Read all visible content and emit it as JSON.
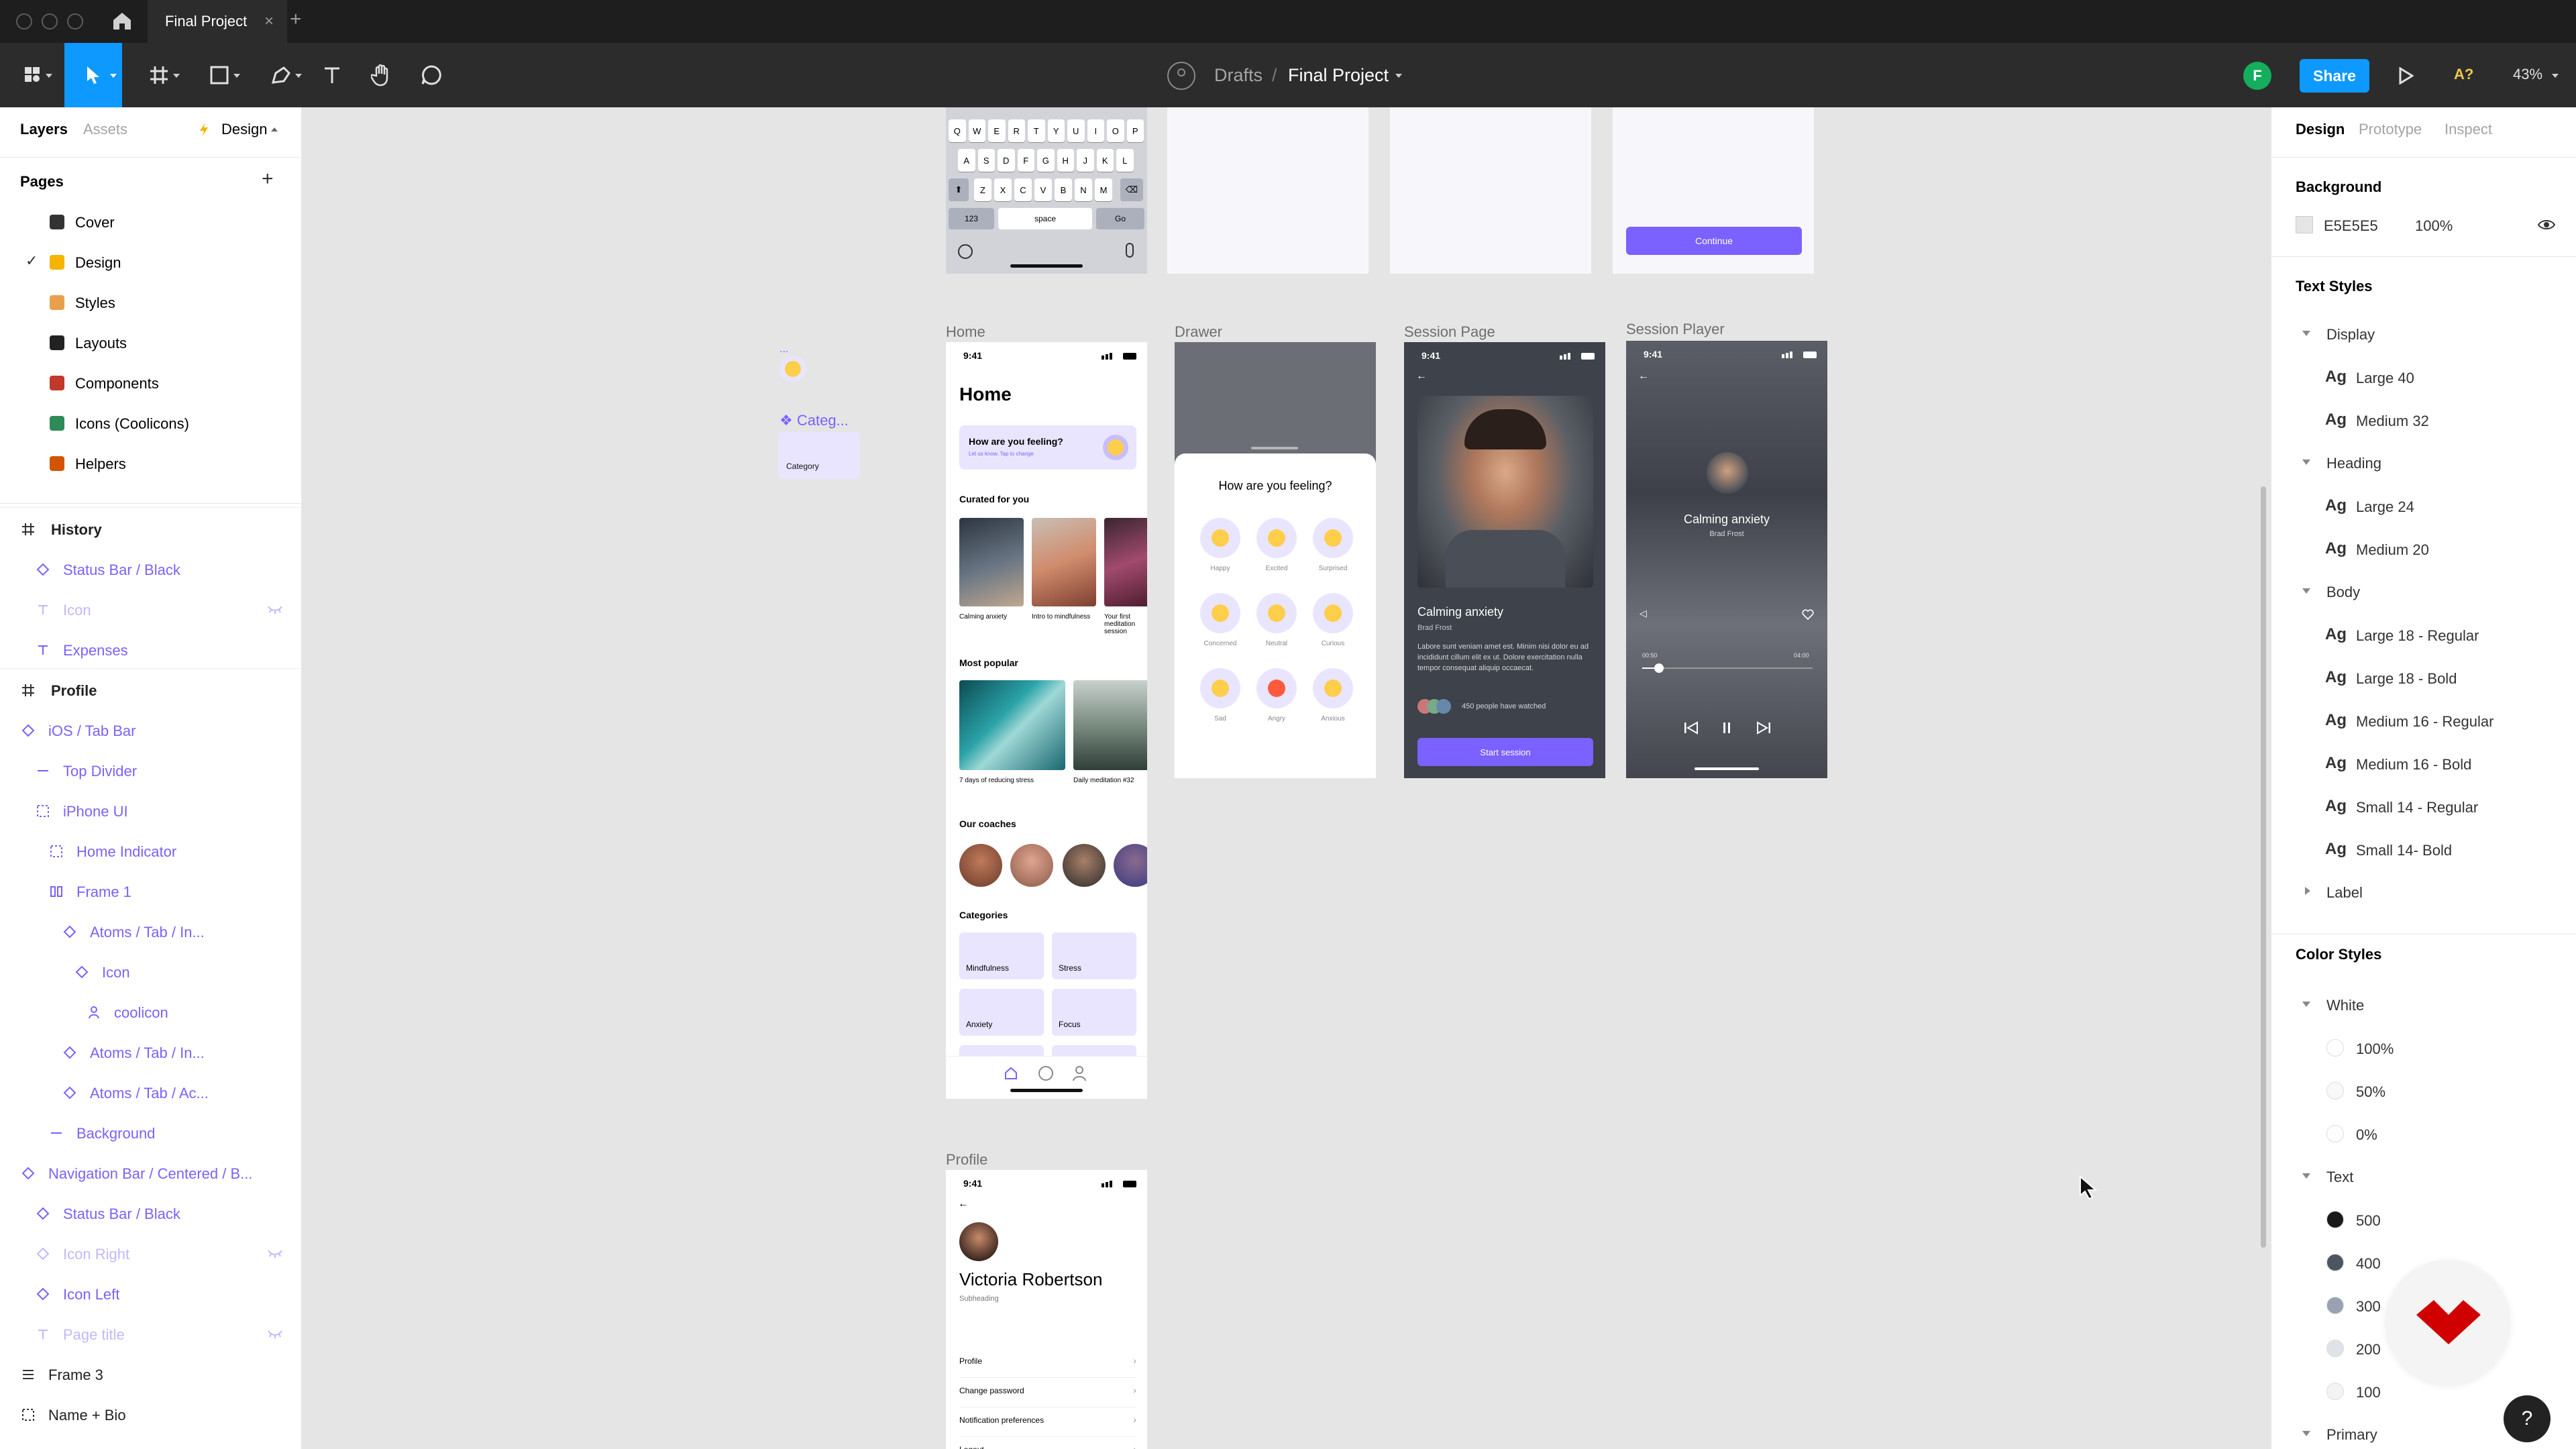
{
  "titlebar": {
    "tab_title": "Final Project",
    "tab_close": "×",
    "new_tab": "+"
  },
  "toolbar": {
    "breadcrumb_drafts": "Drafts",
    "breadcrumb_sep": "/",
    "breadcrumb_project": "Final Project",
    "avatar_initial": "F",
    "share_label": "Share",
    "font_badge": "A?",
    "zoom": "43%"
  },
  "left_panel": {
    "tabs": {
      "layers": "Layers",
      "assets": "Assets",
      "page": "Design"
    },
    "pages_title": "Pages",
    "pages_add": "+",
    "pages": [
      {
        "label": "Cover",
        "emoji_color": "#333333"
      },
      {
        "label": "Design",
        "emoji_color": "#f5b400",
        "current": true
      },
      {
        "label": "Styles",
        "emoji_color": "#e8a04c"
      },
      {
        "label": "Layouts",
        "emoji_color": "#222222"
      },
      {
        "label": "Components",
        "emoji_color": "#c0392b"
      },
      {
        "label": "Icons (Coolicons)",
        "emoji_color": "#2e8b57"
      },
      {
        "label": "Helpers",
        "emoji_color": "#d35400"
      }
    ],
    "layers": [
      {
        "label": "History",
        "type": "frame",
        "indent": 0
      },
      {
        "label": "Status Bar / Black",
        "type": "instance",
        "indent": 1
      },
      {
        "label": "Icon",
        "type": "text",
        "indent": 1,
        "hidden": true
      },
      {
        "label": "Expenses",
        "type": "text",
        "indent": 1
      },
      {
        "label": "Profile",
        "type": "frame",
        "indent": 0
      },
      {
        "label": "iOS / Tab Bar",
        "type": "instance",
        "indent": 0
      },
      {
        "label": "Top Divider",
        "type": "line",
        "indent": 1
      },
      {
        "label": "iPhone UI",
        "type": "group",
        "indent": 1
      },
      {
        "label": "Home Indicator",
        "type": "group",
        "indent": 2
      },
      {
        "label": "Frame 1",
        "type": "autolayout",
        "indent": 2
      },
      {
        "label": "Atoms / Tab / In...",
        "type": "instance",
        "indent": 3
      },
      {
        "label": "Icon",
        "type": "instance",
        "indent": 4
      },
      {
        "label": "coolicon",
        "type": "vector",
        "indent": 5
      },
      {
        "label": "Atoms / Tab / In...",
        "type": "instance",
        "indent": 3
      },
      {
        "label": "Atoms / Tab / Ac...",
        "type": "instance",
        "indent": 3
      },
      {
        "label": "Background",
        "type": "line",
        "indent": 2
      },
      {
        "label": "Navigation Bar / Centered / B...",
        "type": "instance",
        "indent": 0
      },
      {
        "label": "Status Bar / Black",
        "type": "instance",
        "indent": 1
      },
      {
        "label": "Icon Right",
        "type": "instance",
        "indent": 1,
        "hidden": true
      },
      {
        "label": "Icon Left",
        "type": "instance",
        "indent": 1
      },
      {
        "label": "Page title",
        "type": "text",
        "indent": 1,
        "hidden": true
      },
      {
        "label": "Frame 3",
        "type": "autolayout-dark",
        "indent": 0
      },
      {
        "label": "Name + Bio",
        "type": "group-dark",
        "indent": 0
      }
    ]
  },
  "canvas": {
    "keyboard": {
      "row1": [
        "Q",
        "W",
        "E",
        "R",
        "T",
        "Y",
        "U",
        "I",
        "O",
        "P"
      ],
      "row2": [
        "A",
        "S",
        "D",
        "F",
        "G",
        "H",
        "J",
        "K",
        "L"
      ],
      "row3": [
        "Z",
        "X",
        "C",
        "V",
        "B",
        "N",
        "M"
      ],
      "num_key": "123",
      "space_key": "space",
      "go_key": "Go"
    },
    "continue_label": "Continue",
    "component_label": "Categ...",
    "component_dots": "...",
    "component_card_label": "Category",
    "home": {
      "frame_label": "Home",
      "time": "9:41",
      "title": "Home",
      "feeling_q": "How are you feeling?",
      "feeling_sub": "Let us know. Tap to change",
      "curated_title": "Curated for you",
      "curated": [
        "Calming anxiety",
        "Intro to mindfulness",
        "Your first meditation session"
      ],
      "popular_title": "Most popular",
      "popular": [
        "7 days of reducing stress",
        "Daily meditation #32"
      ],
      "coaches_title": "Our coaches",
      "categories_title": "Categories",
      "categories": [
        "Mindfulness",
        "Stress",
        "Anxiety",
        "Focus"
      ]
    },
    "drawer": {
      "frame_label": "Drawer",
      "question": "How are you feeling?",
      "moods": [
        "Happy",
        "Excited",
        "Surprised",
        "Concerned",
        "Neutral",
        "Curious",
        "Sad",
        "Angry",
        "Anxious"
      ]
    },
    "session_page": {
      "frame_label": "Session Page",
      "time": "9:41",
      "title": "Calming anxiety",
      "author": "Brad Frost",
      "body": "Labore sunt veniam amet est. Minim nisi dolor eu ad incididunt cillum elit ex ut. Dolore exercitation nulla tempor consequat aliquip occaecat.",
      "watched": "450 people have watched",
      "cta": "Start session"
    },
    "session_player": {
      "frame_label": "Session Player",
      "time": "9:41",
      "title": "Calming anxiety",
      "author": "Brad Frost",
      "elapsed": "00:50",
      "total": "04:00",
      "progress": 0.1
    },
    "profile": {
      "frame_label": "Profile",
      "time": "9:41",
      "name": "Victoria Robertson",
      "subheading": "Subheading",
      "menu": [
        "Profile",
        "Change password",
        "Notification preferences",
        "Logout"
      ]
    }
  },
  "right_panel": {
    "tabs": {
      "design": "Design",
      "prototype": "Prototype",
      "inspect": "Inspect"
    },
    "background_title": "Background",
    "background_hex": "E5E5E5",
    "background_opacity": "100%",
    "text_styles_title": "Text Styles",
    "text_style_groups": [
      {
        "name": "Display",
        "expanded": true,
        "styles": [
          "Large 40",
          "Medium 32"
        ]
      },
      {
        "name": "Heading",
        "expanded": true,
        "styles": [
          "Large 24",
          "Medium 20"
        ]
      },
      {
        "name": "Body",
        "expanded": true,
        "styles": [
          "Large 18 - Regular",
          "Large 18 - Bold",
          "Medium 16 - Regular",
          "Medium 16 - Bold",
          "Small 14 - Regular",
          "Small 14- Bold"
        ]
      },
      {
        "name": "Label",
        "expanded": false,
        "styles": []
      }
    ],
    "ag": "Ag",
    "color_styles_title": "Color Styles",
    "color_groups": [
      {
        "name": "White",
        "swatches": [
          {
            "label": "100%",
            "color": "#ffffff"
          },
          {
            "label": "50%",
            "color": "#f8f8f8"
          },
          {
            "label": "0%",
            "color": "#fdfdfd"
          }
        ]
      },
      {
        "name": "Text",
        "swatches": [
          {
            "label": "500",
            "color": "#1a1a1a"
          },
          {
            "label": "400",
            "color": "#4e5460"
          },
          {
            "label": "300",
            "color": "#9aa2b1"
          },
          {
            "label": "200",
            "color": "#dfe2e8"
          },
          {
            "label": "100",
            "color": "#f2f3f5"
          }
        ]
      },
      {
        "name": "Primary",
        "swatches": []
      }
    ],
    "help": "?"
  },
  "colors": {
    "accent": "#0d99ff",
    "primary": "#7b61ff",
    "component": "#7b61ff",
    "avatar": "#14ae5c",
    "fab": "#d10000"
  }
}
